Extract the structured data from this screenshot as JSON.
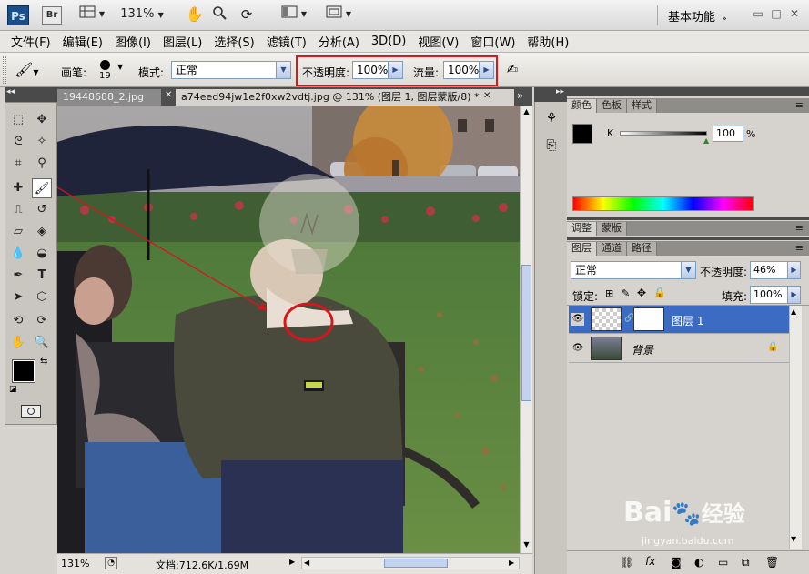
{
  "app": {
    "logo": "Ps",
    "bridge_logo": "Br",
    "zoom_dropdown": "131%",
    "workspace": "基本功能",
    "controls": {
      "minimize": "▭",
      "restore": "□",
      "close": "✕"
    }
  },
  "menu": [
    "文件(F)",
    "编辑(E)",
    "图像(I)",
    "图层(L)",
    "选择(S)",
    "滤镜(T)",
    "分析(A)",
    "3D(D)",
    "视图(V)",
    "窗口(W)",
    "帮助(H)"
  ],
  "options": {
    "brush_label": "画笔:",
    "brush_size": "19",
    "mode_label": "模式:",
    "mode_value": "正常",
    "opacity_label": "不透明度:",
    "opacity_value": "100%",
    "flow_label": "流量:",
    "flow_value": "100%"
  },
  "tabs": [
    {
      "label": "19448688_2.jpg",
      "close": "✕",
      "active": false
    },
    {
      "label": "a74eed94jw1e2f0xw2vdtj.jpg @ 131% (图层 1, 图层蒙版/8) *",
      "close": "✕",
      "active": true
    }
  ],
  "tabs_overflow": "»",
  "status": {
    "zoom": "131%",
    "doc": "文档:712.6K/1.69M"
  },
  "color_panel": {
    "tabs": [
      "颜色",
      "色板",
      "样式"
    ],
    "channel": "K",
    "value": "100",
    "unit": "%"
  },
  "adjust_panel": {
    "tabs": [
      "调整",
      "蒙版"
    ]
  },
  "layers_panel": {
    "tabs": [
      "图层",
      "通道",
      "路径"
    ],
    "blend_mode": "正常",
    "opacity_label": "不透明度:",
    "opacity_value": "46%",
    "lock_label": "锁定:",
    "fill_label": "填充:",
    "fill_value": "100%",
    "layers": [
      {
        "name": "图层 1",
        "selected": true
      },
      {
        "name": "背景",
        "selected": false
      }
    ]
  },
  "watermark": {
    "brand": "Bai",
    "cn": "经验",
    "url": "jingyan.baidu.com"
  }
}
